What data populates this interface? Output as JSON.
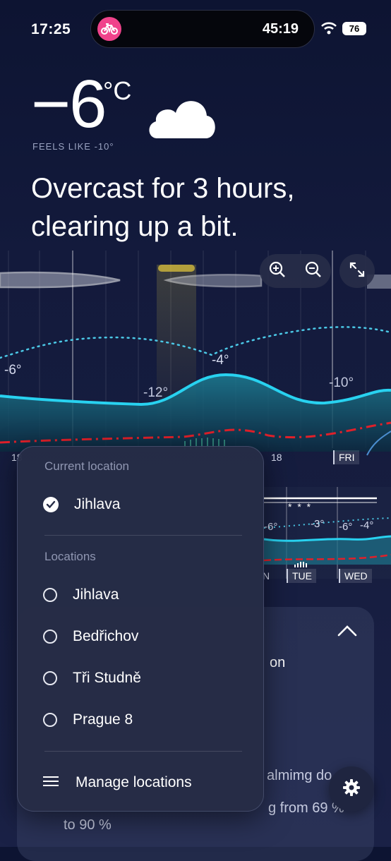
{
  "status": {
    "time": "17:25",
    "timer": "45:19",
    "battery": "76"
  },
  "current": {
    "temp": "−6",
    "unit": "°C",
    "feels_like": "FEELS LIKE -10°",
    "headline": "Overcast for 3 hours, clearing up a bit.",
    "icon": "cloud-icon"
  },
  "chart": {
    "temp_labels": [
      "-6°",
      "-12°",
      "-4°",
      "-10°"
    ],
    "x_ticks": [
      "18",
      "18",
      "FRI"
    ],
    "colors": {
      "temperature": "#28d2f0",
      "feels_like": "#4bc8e6",
      "pressure": "#e0202a"
    }
  },
  "mini_chart": {
    "temp_labels": [
      "-6°",
      "-3°",
      "-6°",
      "-4°"
    ],
    "x_ticks": [
      "N",
      "TUE",
      "WED"
    ],
    "snow": "* * *"
  },
  "card": {
    "line1": "on",
    "line2": "almimg do...",
    "line3": "g from 69 %",
    "line4": "to 90 %"
  },
  "popup": {
    "current_location_header": "Current location",
    "current_location": "Jihlava",
    "locations_header": "Locations",
    "locations": [
      "Jihlava",
      "Bedřichov",
      "Tři Studně",
      "Prague 8"
    ],
    "manage": "Manage locations"
  }
}
